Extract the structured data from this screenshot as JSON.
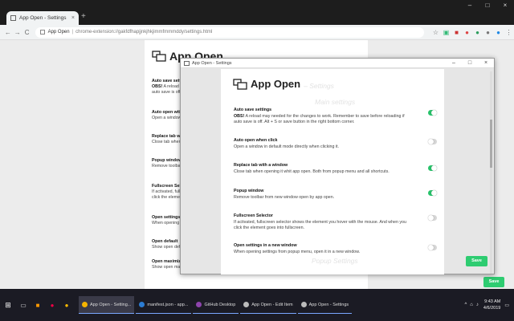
{
  "browser": {
    "tab_title": "App Open - Settings",
    "tab_close": "×",
    "new_tab": "+",
    "window_controls": [
      "–",
      "□",
      "×"
    ],
    "nav": {
      "back": "←",
      "forward": "→",
      "reload": "C"
    },
    "address": {
      "app_label": "App Open",
      "separator": "|",
      "url": "chrome-extension://gakfdfhapjjnkjhkjimmfmmmddy/settings.html"
    },
    "extensions": [
      {
        "icon": "star-icon",
        "glyph": "☆",
        "color": "#666666"
      },
      {
        "icon": "extension-icon",
        "glyph": "▣",
        "color": "#3b7"
      },
      {
        "icon": "extension-icon",
        "glyph": "■",
        "color": "#c33"
      },
      {
        "icon": "extension-icon",
        "glyph": "●",
        "color": "#d44"
      },
      {
        "icon": "extension-icon",
        "glyph": "●",
        "color": "#2a9d5c"
      },
      {
        "icon": "extension-icon",
        "glyph": "●",
        "color": "#777"
      },
      {
        "icon": "extension-icon",
        "glyph": "●",
        "color": "#1e88e5"
      },
      {
        "icon": "menu-icon",
        "glyph": "⋮",
        "color": "#666666"
      }
    ]
  },
  "background_page": {
    "title": "App Open",
    "settings": [
      {
        "label": "Auto save settings",
        "obs": "OBS!",
        "desc": "A reload",
        "desc2": "auto save is off."
      },
      {
        "label": "Auto open with",
        "desc": "Open a window"
      },
      {
        "label": "Replace tab with",
        "desc": "Close tab when"
      },
      {
        "label": "Popup window",
        "desc": "Remove toolbar"
      },
      {
        "label": "Fullscreen Selector",
        "desc": "If activated, fullscreen",
        "desc2": "click the element"
      },
      {
        "label": "Open settings",
        "desc": "When opening"
      },
      {
        "label": "Open default",
        "desc": "Show open default"
      },
      {
        "label": "Open maximized",
        "desc": "Show open maximized button on popup menu."
      }
    ],
    "save_label": "Save"
  },
  "popup": {
    "window_title": "App Open - Settings",
    "window_controls": [
      "–",
      "□",
      "×"
    ],
    "title": "App Open",
    "subtitle": "– Settings",
    "section_main": "Main settings",
    "section_popup": "Popup Settings",
    "settings": [
      {
        "label": "Auto save settings",
        "obs": "OBS!",
        "desc": "A reload may needed for the changes to work. Remember to save before reloading if auto save is off. Alt + S or save button in the right bottom corner.",
        "on": true
      },
      {
        "label": "Auto open when click",
        "desc": "Open a window in default mode directly when clicking it.",
        "on": false
      },
      {
        "label": "Replace tab with a window",
        "desc": "Close tab when opening it whit app open. Both from popup menu and all shortcuts.",
        "on": true
      },
      {
        "label": "Popup window",
        "desc": "Remove toolbar from new window open by app open.",
        "on": true
      },
      {
        "label": "Fullscreen Selector",
        "desc": "If activated, fullscreen selector shows the element you hover with the mouse. And when you click the element goes into fullscreen.",
        "on": false
      },
      {
        "label": "Open settings in a new window",
        "desc": "When opening settings from popup menu, open it in a new window.",
        "on": false
      }
    ],
    "save_label": "Save"
  },
  "taskbar": {
    "apps": [
      {
        "label": "App Open - Setting...",
        "color": "#f4b400"
      },
      {
        "label": "manifest.json - app...",
        "color": "#2b7cd3"
      },
      {
        "label": "GitHub Desktop",
        "color": "#8e44ad"
      },
      {
        "label": "App Open - Edit Item",
        "color": "#bbbbbb"
      },
      {
        "label": "App Open - Settings",
        "color": "#bbbbbb"
      }
    ],
    "time": "9:43 AM",
    "date": "4/6/2019",
    "tray_up": "^",
    "notifications": "▭"
  }
}
